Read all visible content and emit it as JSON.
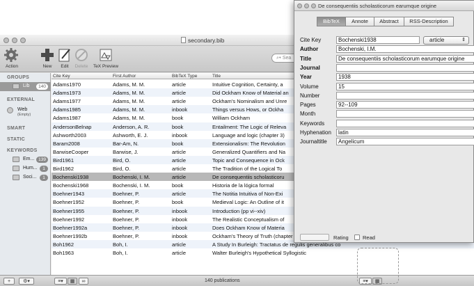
{
  "window": {
    "title": "secondary.bib"
  },
  "toolbar": {
    "items": [
      {
        "label": "Action",
        "icon": "gear-icon"
      },
      {
        "label": "New",
        "icon": "plus-icon"
      },
      {
        "label": "Edit",
        "icon": "pencil-icon"
      },
      {
        "label": "Delete",
        "icon": "delete-icon"
      },
      {
        "label": "TeX Preview",
        "icon": "tex-preview-icon"
      }
    ],
    "search_placeholder": "Sea"
  },
  "sidebar": {
    "groups_header": "GROUPS",
    "library": {
      "label": "Lib",
      "count": "140"
    },
    "external_header": "EXTERNAL",
    "web": {
      "label": "Web",
      "sublabel": "(Empty)"
    },
    "smart_header": "SMART",
    "static_header": "STATIC",
    "keywords_header": "KEYWORDS",
    "keyword_items": [
      {
        "label": "Em...",
        "count": "139"
      },
      {
        "label": "Hum...",
        "count": "1"
      },
      {
        "label": "Soci...",
        "count": "1"
      }
    ]
  },
  "table": {
    "columns": [
      "Cite Key",
      "First Author",
      "BibTeX Type",
      "Title"
    ],
    "rows": [
      [
        "Adams1970",
        "Adams, M. M.",
        "article",
        "Intuitive Cognition, Certainty, a"
      ],
      [
        "Adams1973",
        "Adams, M. M.",
        "article",
        "Did Ockham Know of Material an"
      ],
      [
        "Adams1977",
        "Adams, M. M.",
        "article",
        "Ockham's Nominalism and Unre"
      ],
      [
        "Adams1985",
        "Adams, M. M.",
        "inbook",
        "Things versus Hows, or Ockha"
      ],
      [
        "Adams1987",
        "Adams, M. M.",
        "book",
        "William Ockham"
      ],
      [
        "AndersonBelnap",
        "Anderson, A. R.",
        "book",
        "Entailment: The Logic of Releva"
      ],
      [
        "Ashworth2003",
        "Ashworth, E. J.",
        "inbook",
        "Language and logic (chapter 3)"
      ],
      [
        "Baram2008",
        "Bar-Am, N.",
        "book",
        "Extensionalism: The Revolution"
      ],
      [
        "BarwiseCooper",
        "Barwise, J.",
        "article",
        "Generalized Quantifiers and Na"
      ],
      [
        "Bird1961",
        "Bird, O.",
        "article",
        "Topic and Consequence in Ock"
      ],
      [
        "Bird1962",
        "Bird, O.",
        "article",
        "The Tradition of the Logical To"
      ],
      [
        "Bochenski1938",
        "Bochenski, I. M.",
        "article",
        "De consequentiis scholasticoru"
      ],
      [
        "Bochenski1968",
        "Bochenski, I. M.",
        "book",
        "Historia de la lógica formal"
      ],
      [
        "Boehner1943",
        "Boehner, P.",
        "article",
        "The Notitia Intuitiva of Non-Exi"
      ],
      [
        "Boehner1952",
        "Boehner, P.",
        "book",
        "Medieval Logic: An Outline of it"
      ],
      [
        "Boehner1955",
        "Boehner, P.",
        "inbook",
        "Introduction (pp vi--xiv)"
      ],
      [
        "Boehner1992",
        "Boehner, P.",
        "inbook",
        "The Realistic Conceptualism of"
      ],
      [
        "Boehner1992a",
        "Boehner, P.",
        "inbook",
        "Does Ockham Know of Materia"
      ],
      [
        "Boehner1992b",
        "Boehner, P.",
        "inbook",
        "Ockham's Theory of Truth (chapter 14)"
      ],
      [
        "Boh1962",
        "Boh, I.",
        "article",
        "A Study In Burleigh: Tractatus de regulis generalibus co"
      ],
      [
        "Boh1963",
        "Boh, I.",
        "article",
        "Walter Burleigh's Hypothetical Syllogistic"
      ]
    ],
    "selected_row": 11
  },
  "status": {
    "text": "140 publications"
  },
  "inspector": {
    "title": "De consequentiis scholasticorum earumque origine",
    "tabs": [
      "BibTeX",
      "Annote",
      "Abstract",
      "RSS-Description"
    ],
    "active_tab": "BibTeX",
    "type_select": "article",
    "fields": [
      {
        "label": "Cite Key",
        "value": "Bochenski1938",
        "bold": false
      },
      {
        "label": "Author",
        "value": "Bochenski, I.M.",
        "bold": true
      },
      {
        "label": "Title",
        "value": "De consequentiis scholasticorum earumque origine",
        "bold": true
      },
      {
        "label": "Journal",
        "value": "",
        "bold": true
      },
      {
        "label": "Year",
        "value": "1938",
        "bold": true
      },
      {
        "label": "Volume",
        "value": "15",
        "bold": false
      },
      {
        "label": "Number",
        "value": "",
        "bold": false
      },
      {
        "label": "Pages",
        "value": "92--109",
        "bold": false
      },
      {
        "label": "Month",
        "value": "",
        "bold": false
      },
      {
        "label": "Keywords",
        "value": "",
        "bold": false
      },
      {
        "label": "Hyphenation",
        "value": "latin",
        "bold": false
      },
      {
        "label": "Journaltitle",
        "value": "Angelicum",
        "bold": false
      }
    ],
    "rating_label": "Rating",
    "read_label": "Read"
  }
}
